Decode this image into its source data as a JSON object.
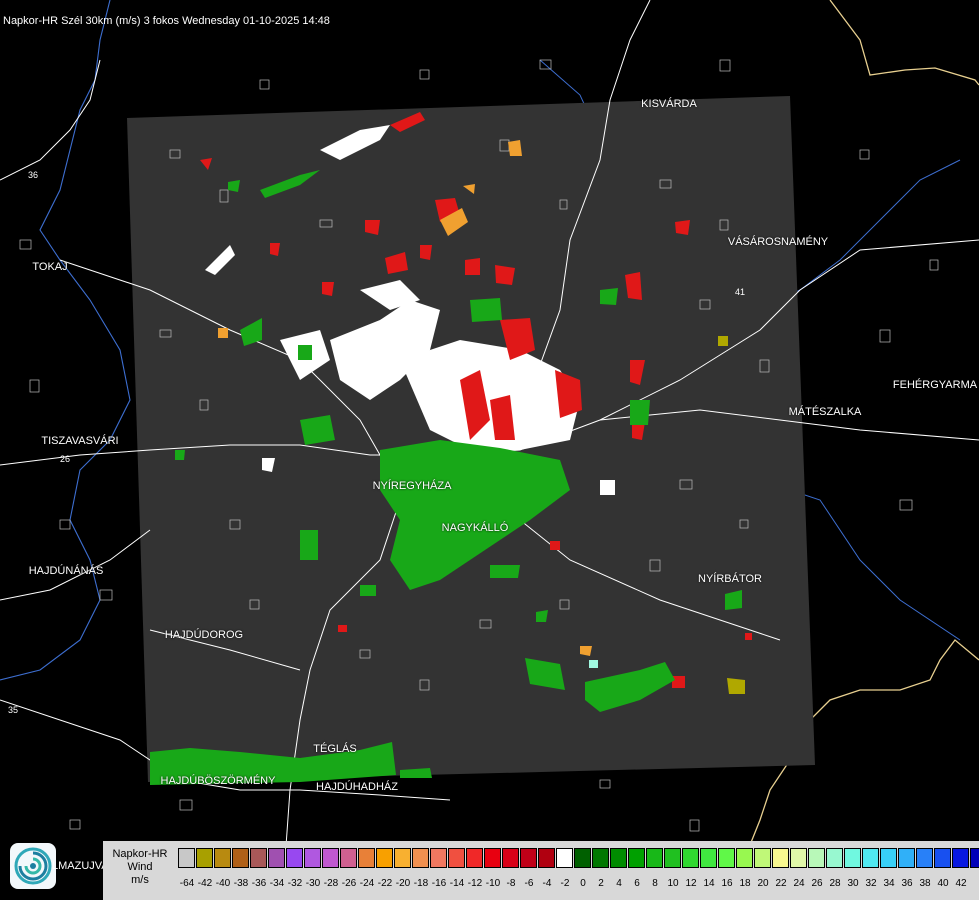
{
  "title": "Napkor-HR Szél 30km (m/s) 3 fokos Wednesday 01-10-2025 14:48",
  "map": {
    "cities": [
      {
        "id": "kisvarda",
        "label": "KISVÁRDA"
      },
      {
        "id": "tokaj",
        "label": "TOKAJ"
      },
      {
        "id": "vasarosnameny",
        "label": "VÁSÁROSNAMÉNY"
      },
      {
        "id": "fehergyarmat",
        "label": "FEHÉRGYARMA"
      },
      {
        "id": "mateszalka",
        "label": "MÁTÉSZALKA"
      },
      {
        "id": "tiszavasvari",
        "label": "TISZAVASVÁRI"
      },
      {
        "id": "nyiregyhaza",
        "label": "NYÍREGYHÁZA"
      },
      {
        "id": "nagykallo",
        "label": "NAGYKÁLLÓ"
      },
      {
        "id": "hajdunanas",
        "label": "HAJDÚNÁNÁS"
      },
      {
        "id": "nyirbator",
        "label": "NYÍRBÁTOR"
      },
      {
        "id": "hajdudorog",
        "label": "HAJDÚDOROG"
      },
      {
        "id": "teglas",
        "label": "TÉGLÁS"
      },
      {
        "id": "hajduboszormeny",
        "label": "HAJDÚBÖSZÖRMÉNY"
      },
      {
        "id": "hajduhadhaz",
        "label": "HAJDÚHADHÁZ"
      }
    ],
    "road_numbers": [
      "36",
      "26",
      "35",
      "41"
    ]
  },
  "logo": {
    "text": "LMAZUJVAR",
    "icon": "swirl-logo-icon"
  },
  "legend": {
    "line1": "Napkor-HR",
    "line2": "Wind",
    "line3": "m/s",
    "colors": [
      "#c8c8c8",
      "#a8a000",
      "#b88a10",
      "#b06018",
      "#a85858",
      "#a050b0",
      "#9848f0",
      "#b058e0",
      "#c058d0",
      "#d06090",
      "#e88038",
      "#f8a000",
      "#f8b030",
      "#f09050",
      "#f07860",
      "#f05040",
      "#f02828",
      "#e80010",
      "#d80018",
      "#c00018",
      "#b00010",
      "#ffffff",
      "#006000",
      "#007800",
      "#008c00",
      "#00a000",
      "#18b818",
      "#20c020",
      "#30d830",
      "#40e840",
      "#60f848",
      "#98f850",
      "#c0f878",
      "#f8f890",
      "#e0f8a8",
      "#b8f8b8",
      "#98f8d0",
      "#70f8e0",
      "#50e8f0",
      "#38d0f8",
      "#30b0f8",
      "#2880f8",
      "#1850f0",
      "#0818e0",
      "#0000b8"
    ],
    "ticks": [
      "-64",
      "-42",
      "-40",
      "-38",
      "-36",
      "-34",
      "-32",
      "-30",
      "-28",
      "-26",
      "-24",
      "-22",
      "-20",
      "-18",
      "-16",
      "-14",
      "-12",
      "-10",
      "-8",
      "-6",
      "-4",
      "-2",
      "0",
      "2",
      "4",
      "6",
      "8",
      "10",
      "12",
      "14",
      "16",
      "18",
      "20",
      "22",
      "24",
      "26",
      "28",
      "30",
      "32",
      "34",
      "36",
      "38",
      "40",
      "42"
    ]
  }
}
